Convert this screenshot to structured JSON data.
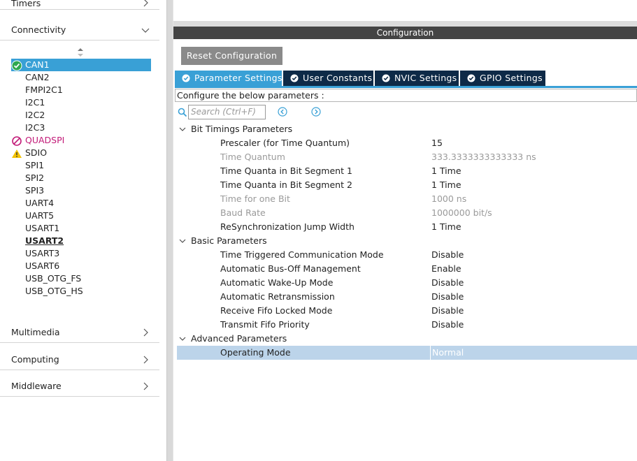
{
  "sidebar": {
    "categories": {
      "timers": "Timers",
      "connectivity": "Connectivity",
      "multimedia": "Multimedia",
      "computing": "Computing",
      "middleware": "Middleware"
    },
    "peripherals": [
      {
        "label": "CAN1",
        "status": "enabled"
      },
      {
        "label": "CAN2",
        "status": "none"
      },
      {
        "label": "FMPI2C1",
        "status": "none"
      },
      {
        "label": "I2C1",
        "status": "none"
      },
      {
        "label": "I2C2",
        "status": "none"
      },
      {
        "label": "I2C3",
        "status": "none"
      },
      {
        "label": "QUADSPI",
        "status": "conflict"
      },
      {
        "label": "SDIO",
        "status": "warning"
      },
      {
        "label": "SPI1",
        "status": "none"
      },
      {
        "label": "SPI2",
        "status": "none"
      },
      {
        "label": "SPI3",
        "status": "none"
      },
      {
        "label": "UART4",
        "status": "none"
      },
      {
        "label": "UART5",
        "status": "none"
      },
      {
        "label": "USART1",
        "status": "none"
      },
      {
        "label": "USART2",
        "status": "configured"
      },
      {
        "label": "USART3",
        "status": "none"
      },
      {
        "label": "USART6",
        "status": "none"
      },
      {
        "label": "USB_OTG_FS",
        "status": "none"
      },
      {
        "label": "USB_OTG_HS",
        "status": "none"
      }
    ]
  },
  "config": {
    "title": "Configuration",
    "reset_label": "Reset Configuration",
    "tabs": [
      {
        "label": "Parameter Settings",
        "active": true
      },
      {
        "label": "User Constants",
        "active": false
      },
      {
        "label": "NVIC Settings",
        "active": false
      },
      {
        "label": "GPIO Settings",
        "active": false
      }
    ],
    "configure_text": "Configure the below parameters :",
    "search_placeholder": "Search (Ctrl+F)",
    "groups": [
      {
        "name": "Bit Timings Parameters",
        "params": [
          {
            "name": "Prescaler (for Time Quantum)",
            "value": "15",
            "dim": false
          },
          {
            "name": "Time Quantum",
            "value": "333.3333333333333 ns",
            "dim": true
          },
          {
            "name": "Time Quanta in Bit Segment 1",
            "value": "1 Time",
            "dim": false
          },
          {
            "name": "Time Quanta in Bit Segment 2",
            "value": "1 Time",
            "dim": false
          },
          {
            "name": "Time for one Bit",
            "value": "1000 ns",
            "dim": true
          },
          {
            "name": "Baud Rate",
            "value": "1000000 bit/s",
            "dim": true
          },
          {
            "name": "ReSynchronization Jump Width",
            "value": "1 Time",
            "dim": false
          }
        ]
      },
      {
        "name": "Basic Parameters",
        "params": [
          {
            "name": "Time Triggered Communication Mode",
            "value": "Disable",
            "dim": false
          },
          {
            "name": "Automatic Bus-Off Management",
            "value": "Enable",
            "dim": false
          },
          {
            "name": "Automatic Wake-Up Mode",
            "value": "Disable",
            "dim": false
          },
          {
            "name": "Automatic Retransmission",
            "value": "Disable",
            "dim": false
          },
          {
            "name": "Receive Fifo Locked Mode",
            "value": "Disable",
            "dim": false
          },
          {
            "name": "Transmit Fifo Priority",
            "value": "Disable",
            "dim": false
          }
        ]
      },
      {
        "name": "Advanced Parameters",
        "params": [
          {
            "name": "Operating Mode",
            "value": "Normal",
            "dim": false,
            "selected": true
          }
        ]
      }
    ]
  },
  "colors": {
    "accent": "#39a0d6",
    "tab_dark": "#0e2a47",
    "warning": "#f2c200",
    "conflict": "#c21b78",
    "enabled": "#2fa84f",
    "selected_row": "#bcd4ea"
  },
  "icons": {
    "chevron_right": "chevron-right-icon",
    "chevron_down": "chevron-down-icon",
    "check": "check-circle-icon",
    "warning": "warning-triangle-icon",
    "conflict": "forbidden-icon",
    "search": "search-icon",
    "prev": "previous-circle-icon",
    "next": "next-circle-icon"
  }
}
